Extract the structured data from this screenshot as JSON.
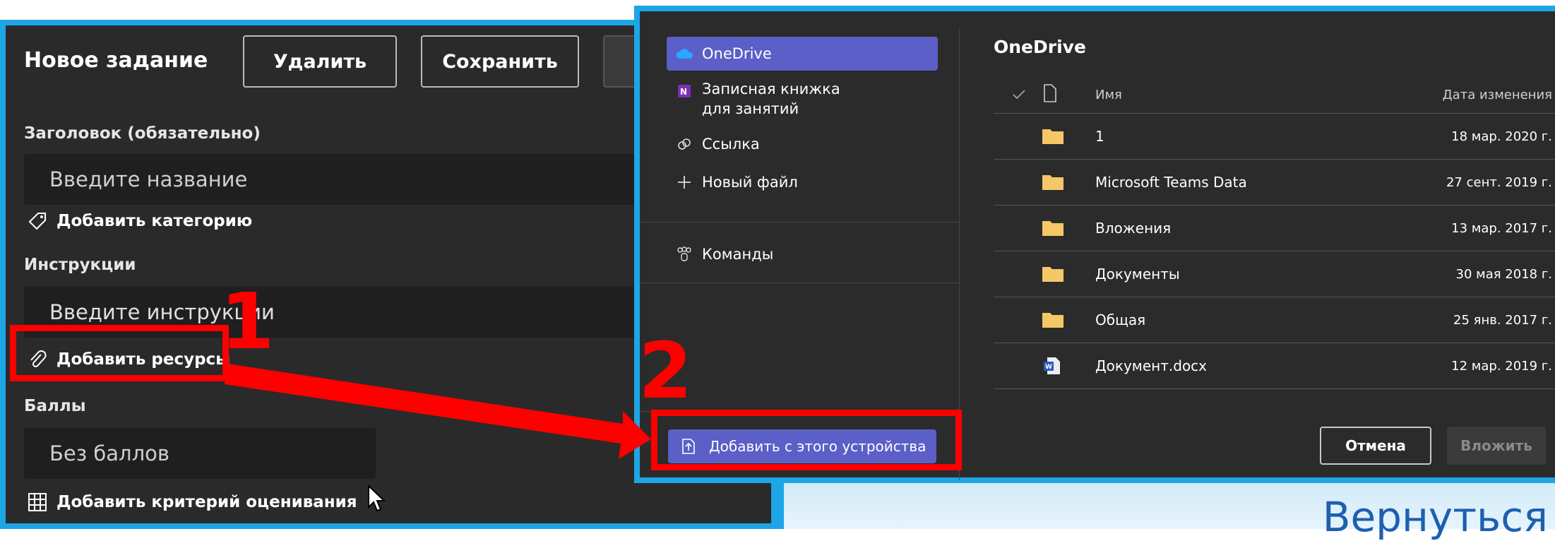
{
  "backdrop": {
    "text": "Вернуться"
  },
  "assignment": {
    "title": "Новое задание",
    "delete_label": "Удалить",
    "save_label": "Сохранить",
    "title_field_label": "Заголовок (обязательно)",
    "title_placeholder": "Введите название",
    "add_category": "Добавить категорию",
    "instructions_label": "Инструкции",
    "instructions_placeholder": "Введите инструкции",
    "add_resources": "Добавить ресурсы",
    "points_label": "Баллы",
    "points_value": "Без баллов",
    "add_rubric": "Добавить критерий оценивания"
  },
  "annotations": {
    "step1": "1",
    "step2": "2",
    "color": "#ff0000"
  },
  "dialog": {
    "nav": [
      {
        "label": "OneDrive",
        "icon": "cloud-icon",
        "selected": true
      },
      {
        "label": "Записная книжка для занятий",
        "icon": "onenote-icon"
      },
      {
        "label": "Ссылка",
        "icon": "link-icon"
      },
      {
        "label": "Новый файл",
        "icon": "plus-icon"
      },
      {
        "label": "Команды",
        "icon": "teams-icon"
      }
    ],
    "upload_label": "Добавить с этого устройства",
    "pane_title": "OneDrive",
    "columns": {
      "name": "Имя",
      "modified": "Дата изменения"
    },
    "files": [
      {
        "name": "1",
        "date": "18 мар. 2020 г.",
        "type": "folder"
      },
      {
        "name": "Microsoft Teams Data",
        "date": "27 сент. 2019 г.",
        "type": "folder"
      },
      {
        "name": "Вложения",
        "date": "13 мар. 2017 г.",
        "type": "folder"
      },
      {
        "name": "Документы",
        "date": "30 мая 2018 г.",
        "type": "folder"
      },
      {
        "name": "Общая",
        "date": "25 янв. 2017 г.",
        "type": "folder"
      },
      {
        "name": "Документ.docx",
        "date": "12 мар. 2019 г.",
        "type": "word"
      }
    ],
    "cancel_label": "Отмена",
    "attach_label": "Вложить"
  },
  "colors": {
    "accent": "#5b5fc7",
    "border": "#1ea5e6",
    "panel": "#2a2a2a",
    "folder": "#f5c767"
  }
}
